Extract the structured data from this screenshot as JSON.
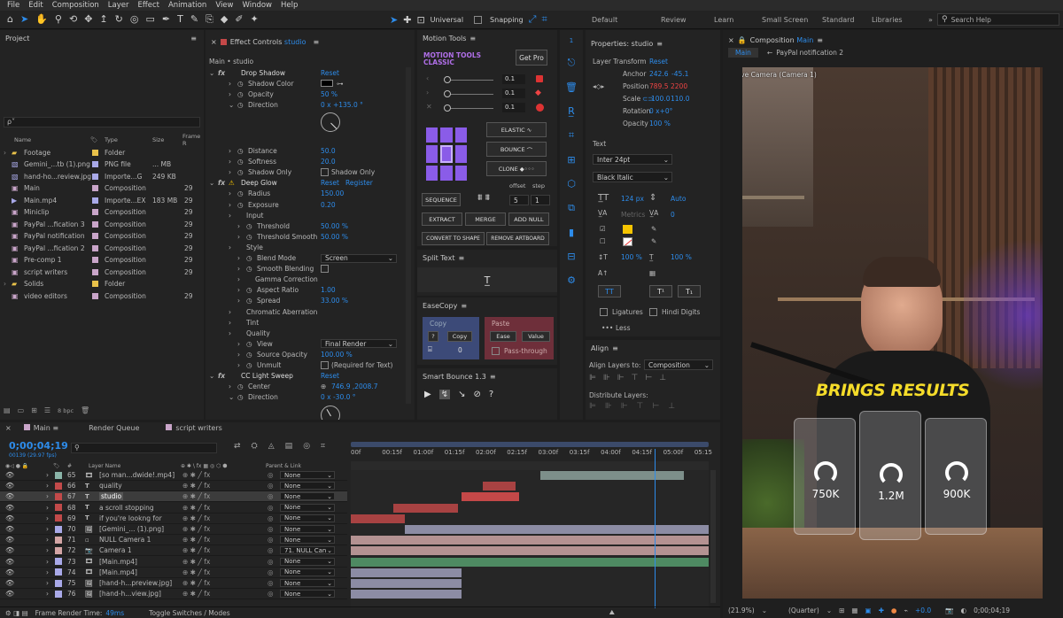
{
  "menu": [
    "File",
    "Edit",
    "Composition",
    "Layer",
    "Effect",
    "Animation",
    "View",
    "Window",
    "Help"
  ],
  "toolbar": {
    "universal": "Universal",
    "snapping": "Snapping"
  },
  "workspaces": [
    "Default",
    "Review",
    "Learn",
    "Small Screen",
    "Standard",
    "Libraries"
  ],
  "search_placeholder": "Search Help",
  "project": {
    "title": "Project",
    "search_glyph": "ρ˅",
    "columns": [
      "Name",
      "Type",
      "Size",
      "Frame R"
    ],
    "items": [
      {
        "name": "Footage",
        "type": "Folder",
        "size": "",
        "frame": "",
        "color": "#e8c14a",
        "icon": "folder-icon"
      },
      {
        "name": "Gemini_...tb (1).png",
        "type": "PNG file",
        "size": "... MB",
        "frame": "",
        "color": "#a9a9e8",
        "icon": "image-file-icon"
      },
      {
        "name": "hand-ho...review.jpg",
        "type": "Importe...G",
        "size": "249 KB",
        "frame": "",
        "color": "#a9a9e8",
        "icon": "image-file-icon"
      },
      {
        "name": "Main",
        "type": "Composition",
        "size": "",
        "frame": "29",
        "color": "#c9a5c9",
        "icon": "composition-icon"
      },
      {
        "name": "Main.mp4",
        "type": "Importe...EX",
        "size": "183 MB",
        "frame": "29",
        "color": "#a9a9e8",
        "icon": "video-file-icon"
      },
      {
        "name": "Miniclip",
        "type": "Composition",
        "size": "",
        "frame": "29",
        "color": "#c9a5c9",
        "icon": "composition-icon"
      },
      {
        "name": "PayPal ...fication 3",
        "type": "Composition",
        "size": "",
        "frame": "29",
        "color": "#c9a5c9",
        "icon": "composition-icon"
      },
      {
        "name": "PayPal notification",
        "type": "Composition",
        "size": "",
        "frame": "29",
        "color": "#c9a5c9",
        "icon": "composition-icon"
      },
      {
        "name": "PayPal ...fication 2",
        "type": "Composition",
        "size": "",
        "frame": "29",
        "color": "#c9a5c9",
        "icon": "composition-icon"
      },
      {
        "name": "Pre-comp 1",
        "type": "Composition",
        "size": "",
        "frame": "29",
        "color": "#c9a5c9",
        "icon": "composition-icon"
      },
      {
        "name": "script writers",
        "type": "Composition",
        "size": "",
        "frame": "29",
        "color": "#c9a5c9",
        "icon": "composition-icon"
      },
      {
        "name": "Solids",
        "type": "Folder",
        "size": "",
        "frame": "",
        "color": "#e8c14a",
        "icon": "folder-icon"
      },
      {
        "name": "video editors",
        "type": "Composition",
        "size": "",
        "frame": "29",
        "color": "#c9a5c9",
        "icon": "composition-icon"
      }
    ],
    "bpc": "8 bpc"
  },
  "effects": {
    "tab": "Effect Controls",
    "tab_target": "studio",
    "header": "Main • studio",
    "props": [
      {
        "label": "Drop Shadow",
        "value": "Reset",
        "kind": "fx",
        "indent": 0
      },
      {
        "label": "Shadow Color",
        "value": "",
        "kind": "color",
        "indent": 1
      },
      {
        "label": "Opacity",
        "value": "50 %",
        "kind": "prop",
        "indent": 1
      },
      {
        "label": "Direction",
        "value": "0 x +135.0 °",
        "kind": "prop-open",
        "indent": 1
      },
      {
        "label": "",
        "value": "",
        "kind": "dial",
        "indent": 1
      },
      {
        "label": "",
        "value": "",
        "kind": "blank",
        "indent": 1
      },
      {
        "label": "Distance",
        "value": "50.0",
        "kind": "prop",
        "indent": 1
      },
      {
        "label": "Softness",
        "value": "20.0",
        "kind": "prop",
        "indent": 1
      },
      {
        "label": "Shadow Only",
        "value": "Shadow Only",
        "kind": "check",
        "indent": 1
      },
      {
        "label": "Deep Glow",
        "value": "Reset",
        "value2": "Register",
        "kind": "fxwarn",
        "indent": 0
      },
      {
        "label": "Radius",
        "value": "150.00",
        "kind": "prop",
        "indent": 1
      },
      {
        "label": "Exposure",
        "value": "0.20",
        "kind": "prop",
        "indent": 1
      },
      {
        "label": "Input",
        "value": "",
        "kind": "group",
        "indent": 1
      },
      {
        "label": "Threshold",
        "value": "50.00 %",
        "kind": "prop",
        "indent": 2
      },
      {
        "label": "Threshold Smooth",
        "value": "50.00 %",
        "kind": "prop",
        "indent": 2
      },
      {
        "label": "Style",
        "value": "",
        "kind": "group",
        "indent": 1
      },
      {
        "label": "Blend Mode",
        "value": "Screen",
        "kind": "dropdown",
        "indent": 2
      },
      {
        "label": "Smooth Blending",
        "value": "",
        "kind": "checkonly",
        "indent": 2
      },
      {
        "label": "Gamma Correction",
        "value": "",
        "kind": "group",
        "indent": 2
      },
      {
        "label": "Aspect Ratio",
        "value": "1.00",
        "kind": "prop",
        "indent": 2
      },
      {
        "label": "Spread",
        "value": "33.00 %",
        "kind": "prop",
        "indent": 2
      },
      {
        "label": "Chromatic Aberration",
        "value": "",
        "kind": "group",
        "indent": 1
      },
      {
        "label": "Tint",
        "value": "",
        "kind": "group",
        "indent": 1
      },
      {
        "label": "Quality",
        "value": "",
        "kind": "group",
        "indent": 1
      },
      {
        "label": "View",
        "value": "Final Render",
        "kind": "dropdown",
        "indent": 2
      },
      {
        "label": "Source Opacity",
        "value": "100.00 %",
        "kind": "prop",
        "indent": 2
      },
      {
        "label": "Unmult",
        "value": "(Required for Text)",
        "kind": "check",
        "indent": 2
      },
      {
        "label": "CC Light Sweep",
        "value": "Reset",
        "kind": "fx",
        "indent": 0
      },
      {
        "label": "Center",
        "value": "746.9 ,2008.7",
        "kind": "point",
        "indent": 1
      },
      {
        "label": "Direction",
        "value": "0 x -30.0 °",
        "kind": "prop-open",
        "indent": 1
      }
    ]
  },
  "motion_tools": {
    "tab": "Motion Tools",
    "brand1": "MOTION TOOLS",
    "brand2": "CLASSIC",
    "get_pro": "Get Pro",
    "sliders": [
      "0.1",
      "0.1",
      "0.1"
    ],
    "elastic": "ELASTIC",
    "bounce": "BOUNCE",
    "clone": "CLONE",
    "sequence": "SEQUENCE",
    "offset_label": "offset",
    "step_label": "step",
    "offset": "5",
    "step": "1",
    "extract": "EXTRACT",
    "merge": "MERGE",
    "add_null": "ADD NULL",
    "convert": "CONVERT TO SHAPE",
    "remove_artboard": "REMOVE ARTBOARD",
    "split_text": "Split Text",
    "easecopy": "EaseCopy",
    "copy_label": "Copy",
    "copy_btn": "Copy",
    "copy_q": "?",
    "copy_count": "0",
    "paste_label": "Paste",
    "ease_btn": "Ease",
    "value_btn": "Value",
    "pass_through": "Pass-through",
    "smart_bounce": "Smart Bounce 1.3"
  },
  "properties": {
    "title": "Properties: studio",
    "layer_transform": "Layer Transform",
    "reset": "Reset",
    "anchor": {
      "label": "Anchor",
      "x": "242.6",
      "y": "-45.1"
    },
    "position": {
      "label": "Position",
      "x": "789.5",
      "y": "2200"
    },
    "scale": {
      "label": "Scale",
      "x": "100.0",
      "y": "110.0"
    },
    "rotation": {
      "label": "Rotation",
      "value": "0 x+0°"
    },
    "opacity": {
      "label": "Opacity",
      "value": "100 %"
    },
    "text_header": "Text",
    "font": "Inter 24pt",
    "style": "Black Italic",
    "size": "124 px",
    "leading": "Auto",
    "metrics": "Metrics",
    "tracking": "0",
    "vscale": "100 %",
    "hscale": "100 %",
    "tt": "TT",
    "tsup": "T¹",
    "tsub": "T₁",
    "ligatures": "Ligatures",
    "hindi": "Hindi Digits",
    "less": "Less",
    "align_header": "Align",
    "align_to_label": "Align Layers to:",
    "align_to": "Composition",
    "distribute": "Distribute Layers:",
    "fill_color": "#f5c400"
  },
  "composition": {
    "tab": "Composition",
    "tab_target": "Main",
    "crumbs": [
      "Main",
      "PayPal notification 2"
    ],
    "active_camera": "Active Camera (Camera 1)",
    "headline": "BRINGS RESULTS",
    "cards": [
      "750K",
      "1.2M",
      "900K"
    ],
    "zoom": "(21.9%)",
    "quality": "(Quarter)",
    "exposure": "+0.0",
    "timecode": "0;00;04;19"
  },
  "timeline": {
    "tabs": [
      "Main",
      "Render Queue",
      "script writers"
    ],
    "timecode": "0;00;04;19",
    "fps": "00139 (29.97 fps)",
    "col_layer": "Layer Name",
    "col_parent": "Parent & Link",
    "ruler": [
      "00f",
      "00:15f",
      "01:00f",
      "01:15f",
      "02:00f",
      "02:15f",
      "03:00f",
      "03:15f",
      "04:00f",
      "04:15f",
      "05:00f",
      "05:15"
    ],
    "layers": [
      {
        "num": "65",
        "type": "mp4-icon",
        "name": "[so man...dwide!.mp4]",
        "parent": "None",
        "color": "#8ab4a8",
        "sel": false,
        "bar": {
          "from": 0.53,
          "to": 0.93,
          "color": "#7d8f8a"
        }
      },
      {
        "num": "66",
        "type": "T",
        "name": "quality",
        "parent": "None",
        "color": "#c24a4a",
        "sel": false,
        "bar": {
          "from": 0.37,
          "to": 0.46,
          "color": "#a84242"
        }
      },
      {
        "num": "67",
        "type": "T",
        "name": "studio",
        "parent": "None",
        "color": "#c24a4a",
        "sel": true,
        "bar": {
          "from": 0.31,
          "to": 0.47,
          "color": "#c44848"
        }
      },
      {
        "num": "68",
        "type": "T",
        "name": "a scroll stopping",
        "parent": "None",
        "color": "#c24a4a",
        "sel": false,
        "bar": {
          "from": 0.12,
          "to": 0.3,
          "color": "#a84242"
        }
      },
      {
        "num": "69",
        "type": "T",
        "name": "if you're lookng for",
        "parent": "None",
        "color": "#c24a4a",
        "sel": false,
        "bar": {
          "from": 0.0,
          "to": 0.15,
          "color": "#a84242"
        }
      },
      {
        "num": "70",
        "type": "img-icon",
        "name": "[Gemini_... (1).png]",
        "parent": "None",
        "color": "#a9a9e8",
        "sel": false,
        "bar": {
          "from": 0.15,
          "to": 1.0,
          "color": "#8c8ca4"
        }
      },
      {
        "num": "71",
        "type": "NULL",
        "name": "NULL Camera 1",
        "parent": "None",
        "color": "#d4a5a5",
        "sel": false,
        "bar": {
          "from": 0.0,
          "to": 1.0,
          "color": "#b49292"
        }
      },
      {
        "num": "72",
        "type": "cam-icon",
        "name": "Camera 1",
        "parent": "71. NULL Can",
        "color": "#d4a5a5",
        "sel": false,
        "bar": {
          "from": 0.0,
          "to": 1.0,
          "color": "#b49292"
        }
      },
      {
        "num": "73",
        "type": "comp-icon",
        "name": "[Main.mp4]",
        "parent": "None",
        "color": "#a9a9e8",
        "sel": false,
        "bar": {
          "from": 0.0,
          "to": 1.0,
          "color": "#4e8a62"
        }
      },
      {
        "num": "74",
        "type": "comp-icon",
        "name": "[Main.mp4]",
        "parent": "None",
        "color": "#a9a9e8",
        "sel": false,
        "bar": {
          "from": 0.0,
          "to": 0.31,
          "color": "#8c8ca4"
        }
      },
      {
        "num": "75",
        "type": "img-icon",
        "name": "[hand-h...preview.jpg]",
        "parent": "None",
        "color": "#a9a9e8",
        "sel": false,
        "bar": {
          "from": 0.0,
          "to": 0.31,
          "color": "#8c8ca4"
        }
      },
      {
        "num": "76",
        "type": "img-icon",
        "name": "[hand-h...view.jpg]",
        "parent": "None",
        "color": "#a9a9e8",
        "sel": false,
        "bar": {
          "from": 0.0,
          "to": 0.31,
          "color": "#8c8ca4"
        }
      }
    ],
    "playhead": 0.85,
    "render_time_label": "Frame Render Time:",
    "render_time": "49ms",
    "toggle": "Toggle Switches / Modes"
  }
}
